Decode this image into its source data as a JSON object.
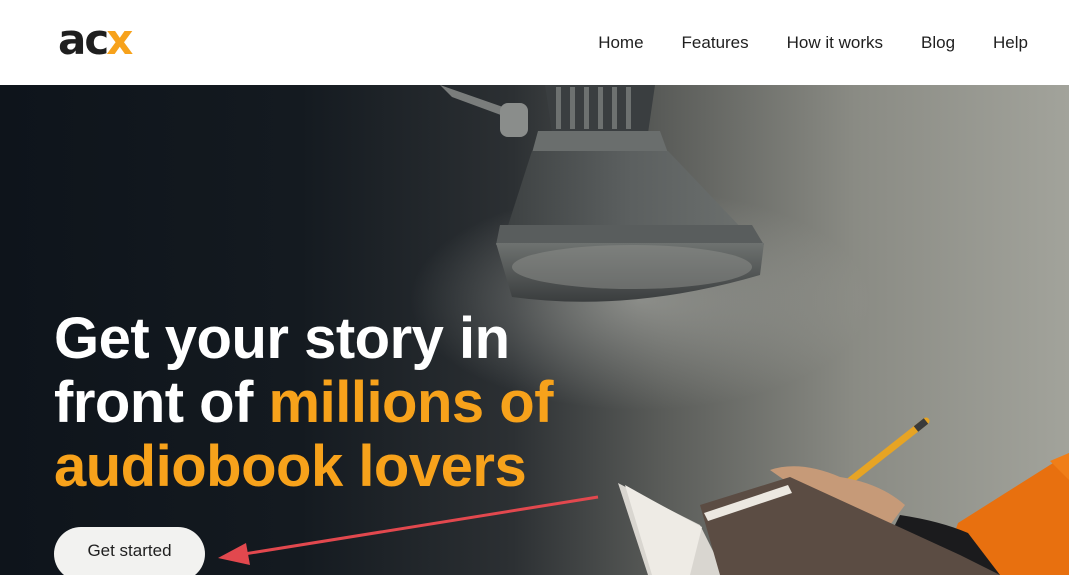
{
  "header": {
    "logo": {
      "text_main": "ac",
      "text_accent": "x",
      "accent_color": "#f7a21b"
    },
    "nav": [
      {
        "label": "Home"
      },
      {
        "label": "Features"
      },
      {
        "label": "How it works"
      },
      {
        "label": "Blog"
      },
      {
        "label": "Help"
      }
    ]
  },
  "hero": {
    "heading_line1": "Get your story in",
    "heading_line2_plain": "front of ",
    "heading_line2_accent": "millions of",
    "heading_line3_accent": "audiobook lovers",
    "cta_label": "Get started",
    "accent_color": "#f7a21b",
    "annotation_color": "#e2484e"
  }
}
